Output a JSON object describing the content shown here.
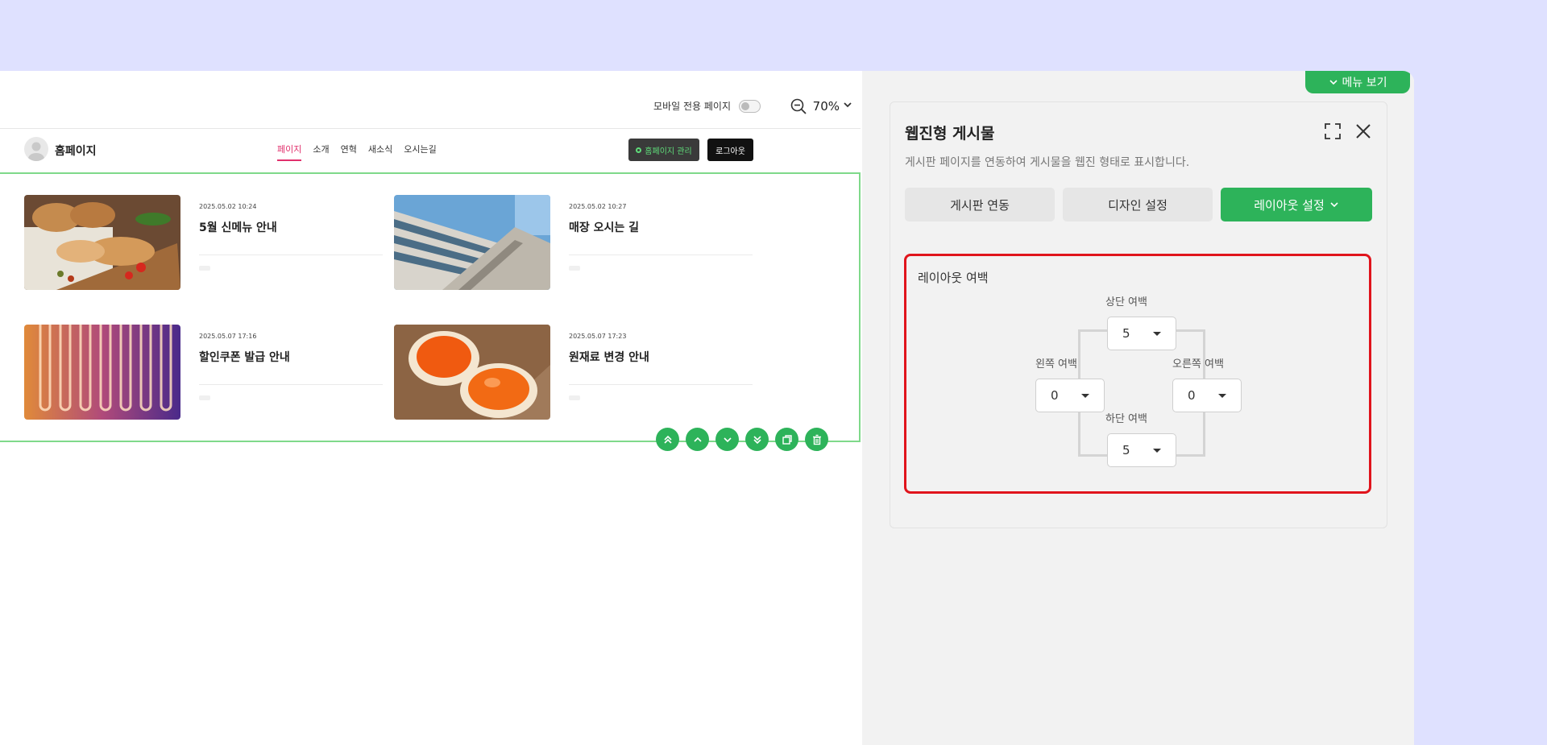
{
  "toolbar": {
    "mobile_label": "모바일 전용 페이지",
    "zoom_value": "70%"
  },
  "site": {
    "logo_text": "홈페이지",
    "nav": [
      {
        "label": "페이지",
        "active": true
      },
      {
        "label": "소개"
      },
      {
        "label": "연혁"
      },
      {
        "label": "새소식"
      },
      {
        "label": "오시는길"
      }
    ],
    "admin_label": "홈페이지 관리",
    "logout_label": "로그아웃"
  },
  "board": {
    "posts": [
      {
        "date": "2025.05.02 10:24",
        "title": "5월 신메뉴 안내",
        "thumb": "bread"
      },
      {
        "date": "2025.05.02 10:27",
        "title": "매장 오시는 길",
        "thumb": "building"
      },
      {
        "date": "2025.05.07 17:16",
        "title": "할인쿠폰 발급 안내",
        "thumb": "neon"
      },
      {
        "date": "2025.05.07 17:23",
        "title": "원재료 변경 안내",
        "thumb": "egg"
      }
    ]
  },
  "panel": {
    "menu_tab_label": "메뉴 보기",
    "title": "웹진형 게시물",
    "description": "게시판 페이지를 연동하여 게시물을 웹진 형태로 표시합니다.",
    "tabs": {
      "link": "게시판 연동",
      "design": "디자인 설정",
      "layout": "레이아웃 설정"
    },
    "layout": {
      "section_label": "레이아웃 여백",
      "top_label": "상단 여백",
      "top_value": "5",
      "left_label": "왼쪽 여백",
      "left_value": "0",
      "right_label": "오른쪽 여백",
      "right_value": "0",
      "bottom_label": "하단 여백",
      "bottom_value": "5"
    }
  },
  "colors": {
    "accent": "#2db35a",
    "highlight": "#e0141c",
    "nav_active": "#e1306c"
  }
}
